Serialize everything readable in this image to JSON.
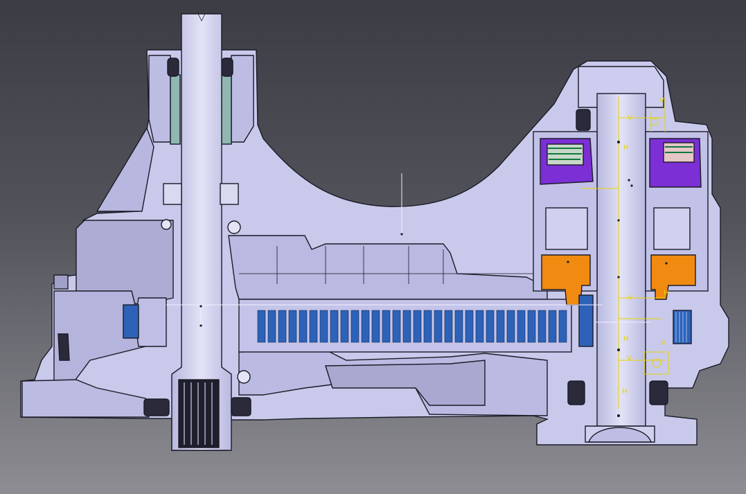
{
  "colors": {
    "body": "#c9c9ec",
    "body_light": "#d8d8f2",
    "body_shade": "#a9a9cf",
    "shaft": "#d3d3f0",
    "edge": "#1a1a26",
    "clutch_blue": "#2d62b8",
    "piston_purple": "#7b2fd4",
    "actuator_orange": "#f08a10",
    "seal_teal": "#90b7b1",
    "annotation_yellow": "#e8d400",
    "background_top": "#3c3c44",
    "background_bottom": "#8d8d93"
  },
  "annotations": {
    "axis_v_1": "V",
    "axis_v_2": "V",
    "axis_v_3": "V",
    "axis_v_4": "V",
    "axis_v_5": "V",
    "axis_h_1": "H",
    "axis_h_2": "H",
    "axis_h_3": "H",
    "axis_h_4": "H"
  }
}
